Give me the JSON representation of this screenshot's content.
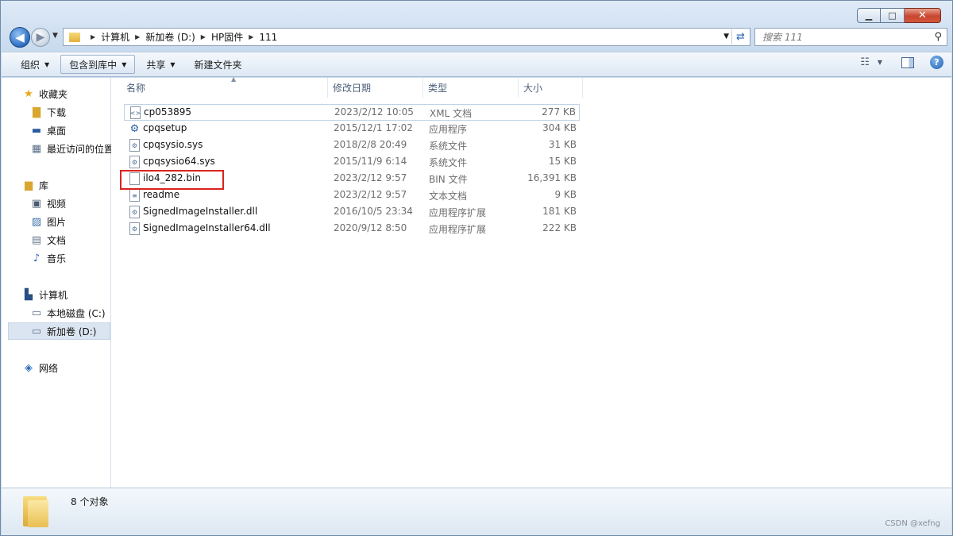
{
  "window": {
    "caption": {
      "minimize": "▁",
      "maximize": "□",
      "close": "✕"
    }
  },
  "nav": {
    "back_icon": "back-arrow-icon",
    "forward_icon": "forward-arrow-icon",
    "breadcrumb": [
      "计算机",
      "新加卷 (D:)",
      "HP固件",
      "111"
    ],
    "search_placeholder": "搜索 111"
  },
  "toolbar": {
    "organize": "组织",
    "include_in_library": "包含到库中",
    "share": "共享",
    "new_folder": "新建文件夹"
  },
  "sidebar": {
    "favorites": {
      "label": "收藏夹",
      "items": [
        "下载",
        "桌面",
        "最近访问的位置"
      ]
    },
    "libraries": {
      "label": "库",
      "items": [
        "视频",
        "图片",
        "文档",
        "音乐"
      ]
    },
    "computer": {
      "label": "计算机",
      "items": [
        "本地磁盘 (C:)",
        "新加卷 (D:)"
      ]
    },
    "network": {
      "label": "网络"
    }
  },
  "columns": {
    "name": "名称",
    "modified": "修改日期",
    "type": "类型",
    "size": "大小"
  },
  "files": [
    {
      "name": "cp053895",
      "modified": "2023/2/12 10:05",
      "type": "XML 文档",
      "size": "277 KB",
      "icon": "xml-file-icon"
    },
    {
      "name": "cpqsetup",
      "modified": "2015/12/1 17:02",
      "type": "应用程序",
      "size": "304 KB",
      "icon": "application-icon"
    },
    {
      "name": "cpqsysio.sys",
      "modified": "2018/2/8 20:49",
      "type": "系统文件",
      "size": "31 KB",
      "icon": "system-file-icon"
    },
    {
      "name": "cpqsysio64.sys",
      "modified": "2015/11/9 6:14",
      "type": "系统文件",
      "size": "15 KB",
      "icon": "system-file-icon"
    },
    {
      "name": "ilo4_282.bin",
      "modified": "2023/2/12 9:57",
      "type": "BIN 文件",
      "size": "16,391 KB",
      "icon": "blank-file-icon"
    },
    {
      "name": "readme",
      "modified": "2023/2/12 9:57",
      "type": "文本文档",
      "size": "9 KB",
      "icon": "text-file-icon"
    },
    {
      "name": "SignedImageInstaller.dll",
      "modified": "2016/10/5 23:34",
      "type": "应用程序扩展",
      "size": "181 KB",
      "icon": "dll-file-icon"
    },
    {
      "name": "SignedImageInstaller64.dll",
      "modified": "2020/9/12 8:50",
      "type": "应用程序扩展",
      "size": "222 KB",
      "icon": "dll-file-icon"
    }
  ],
  "details": {
    "count": "8 个对象"
  },
  "watermark": "CSDN @xefng",
  "colors": {
    "highlight": "#d9241f",
    "selection": "#dbe5f1"
  }
}
